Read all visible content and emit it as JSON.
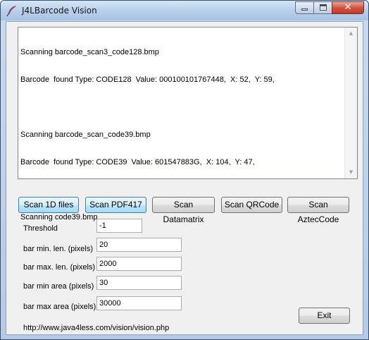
{
  "window": {
    "title": "J4LBarcode Vision"
  },
  "log": {
    "lines": [
      "Scanning barcode_scan3_code128.bmp",
      "Barcode  found Type: CODE128  Value: 000100101767448,  X: 52,  Y: 59,",
      "",
      "Scanning barcode_scan_code39.bmp",
      "Barcode  found Type: CODE39  Value: 601547883G,  X: 104,  Y: 47,",
      "",
      "Scanning code39.bmp"
    ]
  },
  "buttons": {
    "scan_1d": "Scan 1D files",
    "scan_pdf417": "Scan PDF417",
    "scan_datamatrix": "Scan Datamatrix",
    "scan_qrcode": "Scan QRCode",
    "scan_azteccode": "Scan AztecCode",
    "exit": "Exit"
  },
  "settings": {
    "threshold": {
      "label": "Threshold",
      "value": "-1"
    },
    "bar_min_len": {
      "label": "bar min. len. (pixels)",
      "value": "20"
    },
    "bar_max_len": {
      "label": "bar max. len. (pixels)",
      "value": "2000"
    },
    "bar_min_area": {
      "label": "bar min area (pixels)",
      "value": "30"
    },
    "bar_max_area": {
      "label": "bar max area (pixels)",
      "value": "30000"
    }
  },
  "footer": {
    "url": "http://www.java4less.com/vision/vision.php"
  },
  "colors": {
    "title_bar": "#b8d0ea",
    "close_button": "#c23a25",
    "active_button": "#bee6fd"
  },
  "icons": {
    "app": "feather-icon",
    "minimize": "minimize-icon",
    "maximize": "maximize-icon",
    "close": "close-icon"
  }
}
